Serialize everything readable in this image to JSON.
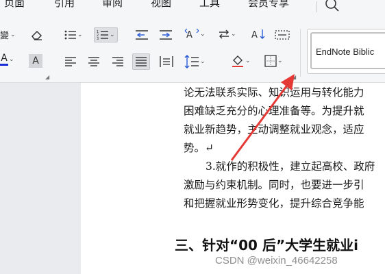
{
  "menu": {
    "items": [
      "页面",
      "引用",
      "审阅",
      "视图",
      "工具",
      "会员专享"
    ]
  },
  "ribbon": {
    "styles_preview": "EndNote Biblic",
    "font_color": "#1a2bd8",
    "highlight_letter": "A",
    "font_letter": "A",
    "arrow_color": "#e53935"
  },
  "document": {
    "lines": [
      "论无法联系实际、知识运用与转化能力",
      "困难缺乏充分的心理准备等。为提升就",
      "就业新趋势，主动调整就业观念，适应",
      "势。↵",
      "3.就作的积极性，建立起高校、政府",
      "激励与约束机制。同时，也要进一步引",
      "和把握就业形势变化，提升综合竞争能"
    ],
    "heading": "三、针对“00 后”大学生就业i"
  },
  "watermark": "CSDN @weixin_46642258"
}
